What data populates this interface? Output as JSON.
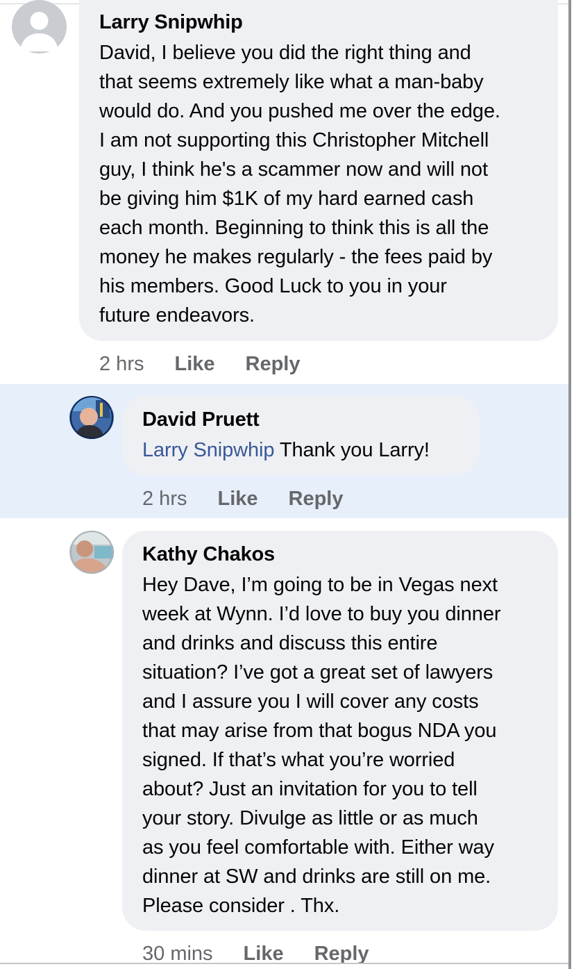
{
  "colors": {
    "bubble": "#eff0f3",
    "highlight": "#e7effb",
    "mention": "#385898",
    "meta_text": "#65676b"
  },
  "comments": [
    {
      "author": "Larry Snipwhip",
      "avatar_icon": "default-user-avatar-icon",
      "lines": [
        "David, I believe you did the right thing and",
        "that seems extremely like what a man-baby",
        "would do. And you pushed me over the edge.",
        "I am not supporting this Christopher Mitchell",
        "guy, I think he's a scammer now and will not",
        "be giving him $1K of my hard earned cash",
        "each month. Beginning to think this is all the",
        "money he makes regularly - the fees paid by",
        "his members. Good Luck to you in your",
        "future endeavors."
      ],
      "time": "2 hrs",
      "like": "Like",
      "reply": "Reply"
    },
    {
      "author": "David Pruett",
      "avatar_icon": "profile-photo-icon",
      "mention": "Larry Snipwhip",
      "text": " Thank you Larry!",
      "time": "2 hrs",
      "like": "Like",
      "reply": "Reply"
    },
    {
      "author": "Kathy Chakos",
      "avatar_icon": "profile-photo-icon",
      "lines": [
        "Hey Dave, I’m going to be in Vegas next",
        "week at Wynn. I’d love to buy you dinner",
        "and drinks and discuss this entire",
        "situation? I’ve got a great set of lawyers",
        "and I assure you I will cover any costs",
        "that may arise from that bogus NDA you",
        "signed. If that’s what you’re worried",
        "about? Just an invitation for you to tell",
        "your story. Divulge as little or as much",
        "as you feel comfortable with. Either way",
        "dinner at SW and drinks are still on me.",
        "Please consider . Thx."
      ],
      "time": "30 mins",
      "like": "Like",
      "reply": "Reply"
    }
  ]
}
